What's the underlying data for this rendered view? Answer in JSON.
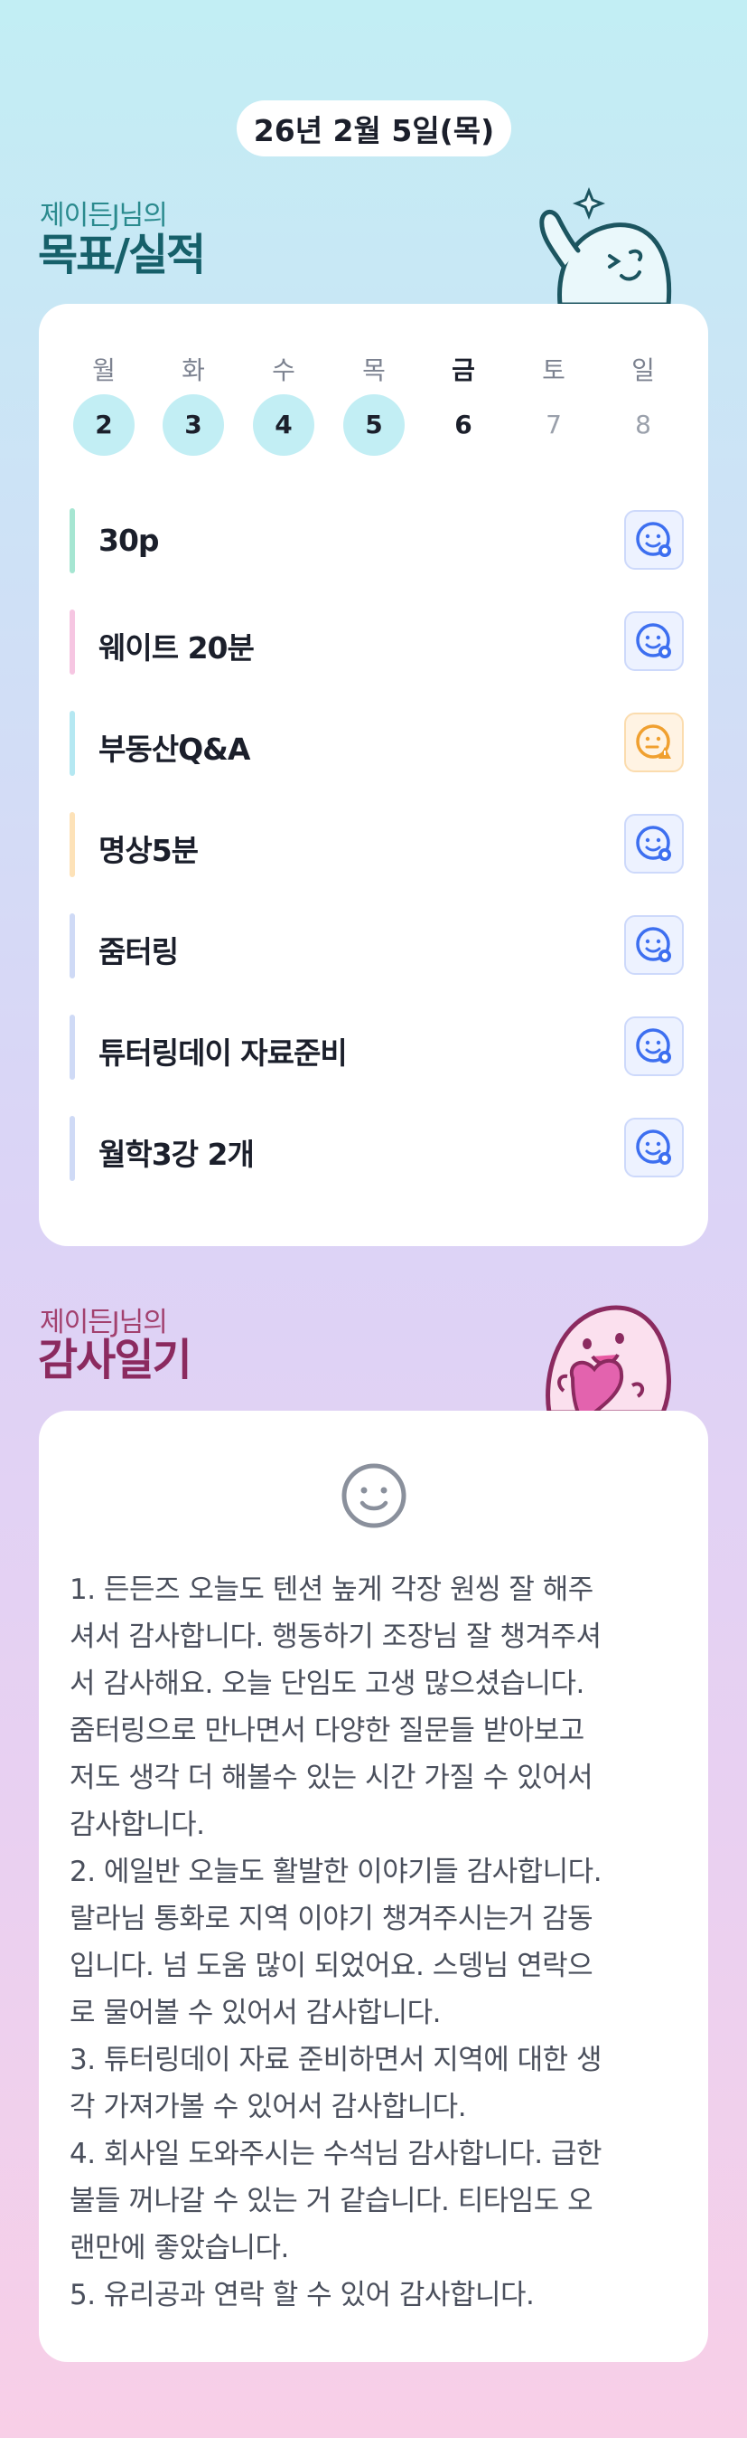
{
  "header": {
    "date": "26년 2월 5일(목)"
  },
  "goals_section": {
    "subtitle": "제이든J님의",
    "title": "목표/실적",
    "week": [
      {
        "dow": "월",
        "day": "2",
        "state": "done"
      },
      {
        "dow": "화",
        "day": "3",
        "state": "done"
      },
      {
        "dow": "수",
        "day": "4",
        "state": "done"
      },
      {
        "dow": "목",
        "day": "5",
        "state": "done"
      },
      {
        "dow": "금",
        "day": "6",
        "state": "today"
      },
      {
        "dow": "토",
        "day": "7",
        "state": "future"
      },
      {
        "dow": "일",
        "day": "8",
        "state": "future"
      }
    ],
    "goals": [
      {
        "text": "30p",
        "bar_color": "#a6e6d2",
        "status": "happy-icon"
      },
      {
        "text": "웨이트 20분",
        "bar_color": "#f6c6e2",
        "status": "happy-icon"
      },
      {
        "text": "부동산Q&A",
        "bar_color": "#b5e8f2",
        "status": "neutral-warning-icon"
      },
      {
        "text": "명상5분",
        "bar_color": "#fde2b8",
        "status": "happy-icon"
      },
      {
        "text": "줌터링",
        "bar_color": "#cfdaf6",
        "status": "happy-icon"
      },
      {
        "text": "튜터링데이 자료준비",
        "bar_color": "#cfdaf6",
        "status": "happy-icon"
      },
      {
        "text": "월학3강 2개",
        "bar_color": "#cfdaf6",
        "status": "happy-icon"
      }
    ]
  },
  "gratitude_section": {
    "subtitle": "제이든J님의",
    "title": "감사일기",
    "icon": "smile-icon",
    "text": "1. 든든즈 오늘도 텐션 높게 각장 원씽 잘 해주\n셔서 감사합니다. 행동하기 조장님 잘 챙겨주셔\n서 감사해요. 오늘 단임도 고생 많으셨습니다.\n줌터링으로 만나면서 다양한 질문들 받아보고\n저도 생각 더 해볼수 있는 시간 가질 수 있어서\n감사합니다.\n2. 에일반 오늘도 활발한 이야기들 감사합니다.\n랄라님 통화로 지역 이야기 챙겨주시는거 감동\n입니다. 넘 도움 많이 되었어요. 스뎅님 연락으\n로 물어볼 수 있어서 감사합니다.\n3. 튜터링데이 자료 준비하면서 지역에 대한 생\n각 가져가볼 수 있어서 감사합니다.\n4. 회사일 도와주시는 수석님 감사합니다. 급한\n불들 꺼나갈 수 있는 거 같습니다. 티타임도 오\n랜만에 좋았습니다.\n5. 유리공과 연락 할 수 있어 감사합니다."
  },
  "colors": {
    "accent_teal": "#16606a",
    "accent_pink": "#8b2a5f",
    "happy_status": "#3d6ff0",
    "warn_status": "#f0a030"
  }
}
